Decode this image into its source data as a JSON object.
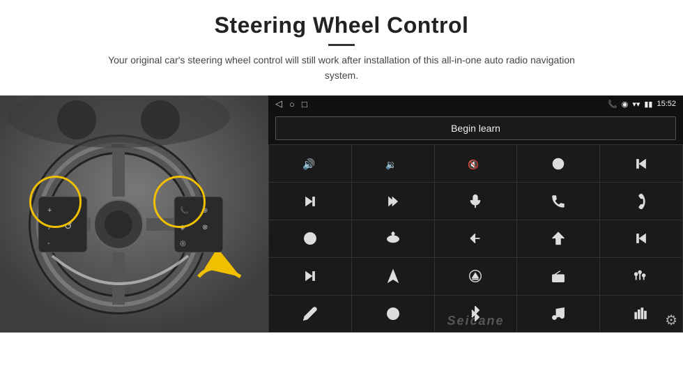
{
  "header": {
    "title": "Steering Wheel Control",
    "subtitle": "Your original car's steering wheel control will still work after installation of this all-in-one auto radio navigation system."
  },
  "status_bar": {
    "time": "15:52",
    "nav_icons": [
      "◁",
      "○",
      "□"
    ]
  },
  "begin_learn_btn": "Begin learn",
  "watermark": "Seicane",
  "grid_icons": [
    "vol_up",
    "vol_down",
    "mute",
    "power",
    "prev_track",
    "next",
    "fast_forward",
    "mic",
    "phone",
    "hang_up",
    "speaker",
    "360",
    "back",
    "home",
    "skip_back",
    "skip_forward",
    "navigate",
    "eject",
    "radio",
    "equalizer",
    "pen",
    "settings_circle",
    "bluetooth",
    "music",
    "bars"
  ]
}
